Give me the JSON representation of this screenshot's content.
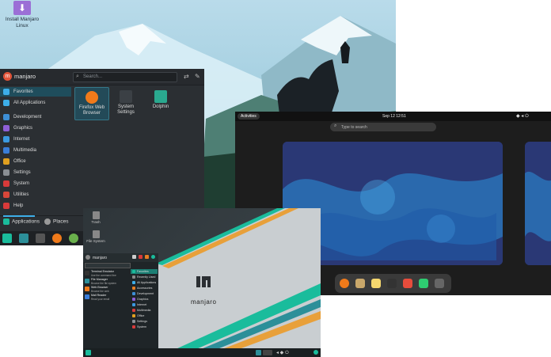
{
  "kde": {
    "desktop_icon": {
      "label_line1": "Install Manjaro",
      "label_line2": "Linux",
      "icon": "download-icon"
    },
    "menu": {
      "username": "manjaro",
      "avatar_letter": "m",
      "search_placeholder": "Search...",
      "categories": [
        {
          "label": "Favorites",
          "icon": "star-icon",
          "color": "#3daee9",
          "selected": true
        },
        {
          "label": "All Applications",
          "icon": "grid-icon",
          "color": "#3daee9",
          "selected": false
        },
        {
          "label": "Development",
          "icon": "development-icon",
          "color": "#3d8fd6",
          "selected": false
        },
        {
          "label": "Graphics",
          "icon": "graphics-icon",
          "color": "#8e5fd6",
          "selected": false
        },
        {
          "label": "Internet",
          "icon": "internet-icon",
          "color": "#3b9ae0",
          "selected": false
        },
        {
          "label": "Multimedia",
          "icon": "multimedia-icon",
          "color": "#3a7ed8",
          "selected": false
        },
        {
          "label": "Office",
          "icon": "office-icon",
          "color": "#e0a020",
          "selected": false
        },
        {
          "label": "Settings",
          "icon": "settings-icon",
          "color": "#8a8f94",
          "selected": false
        },
        {
          "label": "System",
          "icon": "system-icon",
          "color": "#d83a3a",
          "selected": false
        },
        {
          "label": "Utilities",
          "icon": "utilities-icon",
          "color": "#d8473a",
          "selected": false
        },
        {
          "label": "Help",
          "icon": "help-icon",
          "color": "#d83a3a",
          "selected": false
        }
      ],
      "apps": [
        {
          "line1": "Firefox Web",
          "line2": "Browser",
          "icon": "firefox-icon",
          "color": "#f07a1a",
          "selected": true
        },
        {
          "line1": "System",
          "line2": "Settings",
          "icon": "system-settings-icon",
          "color": "#3b4045",
          "selected": false
        },
        {
          "line1": "Dolphin",
          "line2": "",
          "icon": "folder-icon",
          "color": "#2aa98f",
          "selected": false
        }
      ],
      "tabs": [
        {
          "label": "Applications",
          "icon": "applications-icon",
          "color": "#1abc9c"
        },
        {
          "label": "Places",
          "icon": "places-icon",
          "color": "#999"
        }
      ]
    },
    "taskbar_icons": [
      {
        "icon": "manjaro-icon",
        "color": "#1abc9c"
      },
      {
        "icon": "files-icon",
        "color": "#2c8f99"
      },
      {
        "icon": "terminal-icon",
        "color": "#555"
      },
      {
        "icon": "firefox-icon",
        "color": "#f07a1a"
      },
      {
        "icon": "software-icon",
        "color": "#6ab04c"
      }
    ]
  },
  "gnome": {
    "activities_label": "Activities",
    "clock": "Sep 12  12:51",
    "search_placeholder": "Type to search",
    "tray_icons": [
      "network-icon",
      "volume-icon",
      "power-icon"
    ],
    "dock": [
      {
        "icon": "firefox-icon",
        "color": "#f07a1a"
      },
      {
        "icon": "files-icon",
        "color": "#c9a76a"
      },
      {
        "icon": "text-editor-icon",
        "color": "#f5d76e"
      },
      {
        "icon": "terminal-icon",
        "color": "#333"
      },
      {
        "icon": "software-icon",
        "color": "#e74c3c"
      },
      {
        "icon": "help-icon",
        "color": "#2ecc71"
      },
      {
        "icon": "app-grid-icon",
        "color": "#666"
      }
    ]
  },
  "xfce": {
    "trash_label": "Trash",
    "filesystem_label": "File System",
    "username": "manjaro",
    "favorites": [
      {
        "title": "Terminal Emulator",
        "subtitle": "Use the command line",
        "color": "#333"
      },
      {
        "title": "File Manager",
        "subtitle": "Browse the file system",
        "color": "#2c8f99"
      },
      {
        "title": "Web Browser",
        "subtitle": "Browse the web",
        "color": "#f07a1a"
      },
      {
        "title": "Mail Reader",
        "subtitle": "Read your email",
        "color": "#3b7dd8"
      }
    ],
    "categories": [
      {
        "label": "Favorites",
        "color": "#1abc9c",
        "selected": true
      },
      {
        "label": "Recently Used",
        "color": "#888",
        "selected": false
      },
      {
        "label": "All Applications",
        "color": "#3daee9",
        "selected": false
      },
      {
        "label": "Accessories",
        "color": "#e67e22",
        "selected": false
      },
      {
        "label": "Development",
        "color": "#3d8fd6",
        "selected": false
      },
      {
        "label": "Graphics",
        "color": "#8e5fd6",
        "selected": false
      },
      {
        "label": "Internet",
        "color": "#3b9ae0",
        "selected": false
      },
      {
        "label": "Multimedia",
        "color": "#d83a3a",
        "selected": false
      },
      {
        "label": "Office",
        "color": "#e0a020",
        "selected": false
      },
      {
        "label": "Settings",
        "color": "#8a8f94",
        "selected": false
      },
      {
        "label": "System",
        "color": "#d83a3a",
        "selected": false
      }
    ],
    "logo_text": "manjaro"
  }
}
